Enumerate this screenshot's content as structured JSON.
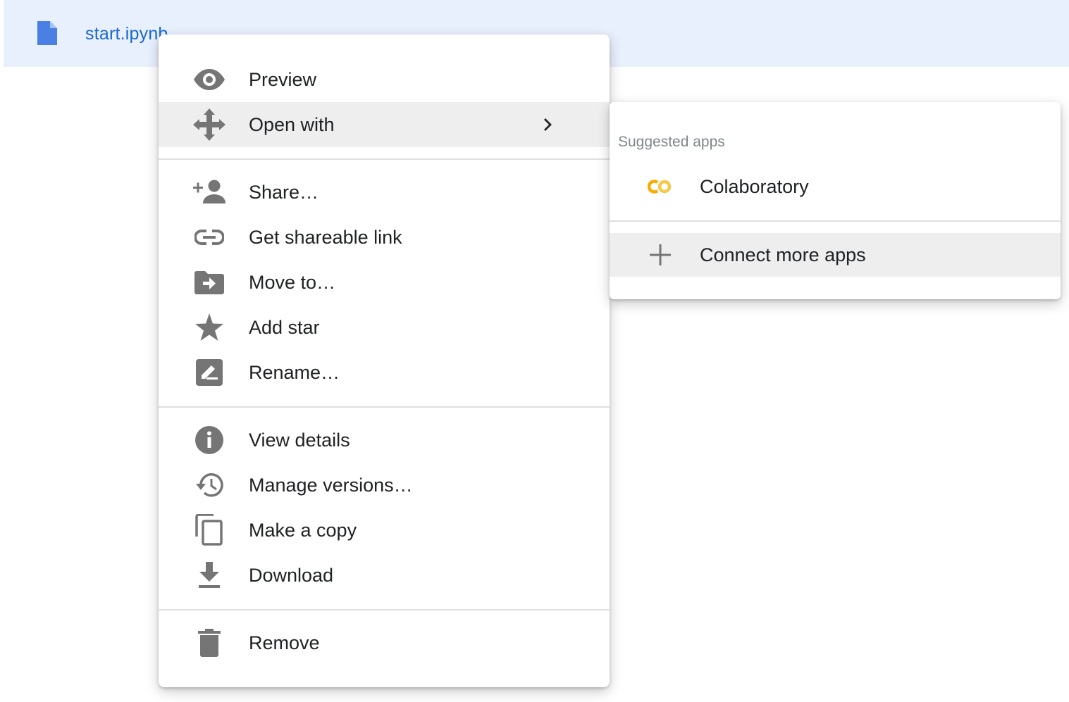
{
  "file": {
    "name": "start.ipynb",
    "icon": "file-icon"
  },
  "colors": {
    "selected_row": "#e8f0fe",
    "file_link": "#1967d2",
    "file_icon": "#4a7fe3",
    "menu_icon": "#757575",
    "hover_bg": "#eeeeee",
    "colab_logo": "#f9ab00"
  },
  "context_menu": {
    "items": [
      {
        "label": "Preview",
        "icon": "eye-icon"
      },
      {
        "label": "Open with",
        "icon": "move-arrows-icon",
        "has_submenu": true,
        "active": true
      },
      {
        "label": "Share…",
        "icon": "person-add-icon"
      },
      {
        "label": "Get shareable link",
        "icon": "link-icon"
      },
      {
        "label": "Move to…",
        "icon": "folder-move-icon"
      },
      {
        "label": "Add star",
        "icon": "star-icon"
      },
      {
        "label": "Rename…",
        "icon": "edit-icon"
      },
      {
        "label": "View details",
        "icon": "info-icon"
      },
      {
        "label": "Manage versions…",
        "icon": "history-icon"
      },
      {
        "label": "Make a copy",
        "icon": "copy-icon"
      },
      {
        "label": "Download",
        "icon": "download-icon"
      },
      {
        "label": "Remove",
        "icon": "trash-icon"
      }
    ]
  },
  "open_with_submenu": {
    "header": "Suggested apps",
    "apps": [
      {
        "label": "Colaboratory",
        "icon": "colab-logo-icon",
        "logo_text": "CO"
      }
    ],
    "connect": {
      "label": "Connect more apps",
      "icon": "plus-icon",
      "active": true
    }
  }
}
